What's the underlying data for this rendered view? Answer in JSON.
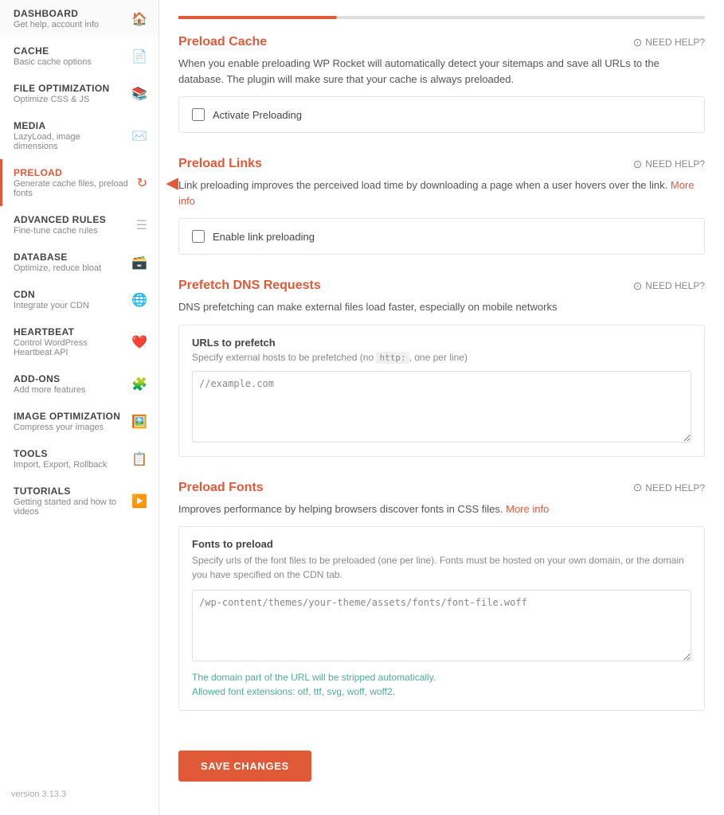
{
  "sidebar": {
    "items": [
      {
        "id": "dashboard",
        "title": "DASHBOARD",
        "sub": "Get help, account info",
        "icon": "🏠",
        "active": false
      },
      {
        "id": "cache",
        "title": "CACHE",
        "sub": "Basic cache options",
        "icon": "📄",
        "active": false
      },
      {
        "id": "file-optimization",
        "title": "FILE OPTIMIZATION",
        "sub": "Optimize CSS & JS",
        "icon": "📚",
        "active": false
      },
      {
        "id": "media",
        "title": "MEDIA",
        "sub": "LazyLoad, image dimensions",
        "icon": "✉️",
        "active": false
      },
      {
        "id": "preload",
        "title": "PRELOAD",
        "sub": "Generate cache files, preload fonts",
        "icon": "🔄",
        "active": true
      },
      {
        "id": "advanced-rules",
        "title": "ADVANCED RULES",
        "sub": "Fine-tune cache rules",
        "icon": "☰",
        "active": false
      },
      {
        "id": "database",
        "title": "DATABASE",
        "sub": "Optimize, reduce bloat",
        "icon": "🗃️",
        "active": false
      },
      {
        "id": "cdn",
        "title": "CDN",
        "sub": "Integrate your CDN",
        "icon": "🌐",
        "active": false
      },
      {
        "id": "heartbeat",
        "title": "HEARTBEAT",
        "sub": "Control WordPress Heartbeat API",
        "icon": "❤️",
        "active": false
      },
      {
        "id": "add-ons",
        "title": "ADD-ONS",
        "sub": "Add more features",
        "icon": "🧩",
        "active": false
      },
      {
        "id": "image-optimization",
        "title": "IMAGE OPTIMIZATION",
        "sub": "Compress your images",
        "icon": "🖼️",
        "active": false
      },
      {
        "id": "tools",
        "title": "TOOLS",
        "sub": "Import, Export, Rollback",
        "icon": "📋",
        "active": false
      },
      {
        "id": "tutorials",
        "title": "TUTORIALS",
        "sub": "Getting started and how to videos",
        "icon": "▶️",
        "active": false
      }
    ],
    "version": "version 3.13.3"
  },
  "main": {
    "sections": [
      {
        "id": "preload-cache",
        "title": "Preload Cache",
        "need_help": "NEED HELP?",
        "desc": "When you enable preloading WP Rocket will automatically detect your sitemaps and save all URLs to the database. The plugin will make sure that your cache is always preloaded.",
        "option_label": "Activate Preloading",
        "checked": false
      },
      {
        "id": "preload-links",
        "title": "Preload Links",
        "need_help": "NEED HELP?",
        "desc": "Link preloading improves the perceived load time by downloading a page when a user hovers over the link.",
        "desc_link": "More info",
        "option_label": "Enable link preloading",
        "checked": false
      },
      {
        "id": "prefetch-dns",
        "title": "Prefetch DNS Requests",
        "need_help": "NEED HELP?",
        "desc": "DNS prefetching can make external files load faster, especially on mobile networks",
        "urls_title": "URLs to prefetch",
        "urls_sub": "Specify external hosts to be prefetched (no",
        "urls_code": "http:",
        "urls_sub2": ", one per line)",
        "textarea_placeholder": "//example.com"
      },
      {
        "id": "preload-fonts",
        "title": "Preload Fonts",
        "need_help": "NEED HELP?",
        "desc": "Improves performance by helping browsers discover fonts in CSS files.",
        "desc_link": "More info",
        "fonts_title": "Fonts to preload",
        "fonts_sub": "Specify urls of the font files to be preloaded (one per line). Fonts must be hosted on your own domain, or the domain you have specified on the CDN tab.",
        "fonts_placeholder": "/wp-content/themes/your-theme/assets/fonts/font-file.woff",
        "fonts_note1": "The domain part of the URL will be stripped automatically.",
        "fonts_note2": "Allowed font extensions: otf, ttf, svg, woff, woff2."
      }
    ],
    "save_label": "SAVE CHANGES"
  }
}
